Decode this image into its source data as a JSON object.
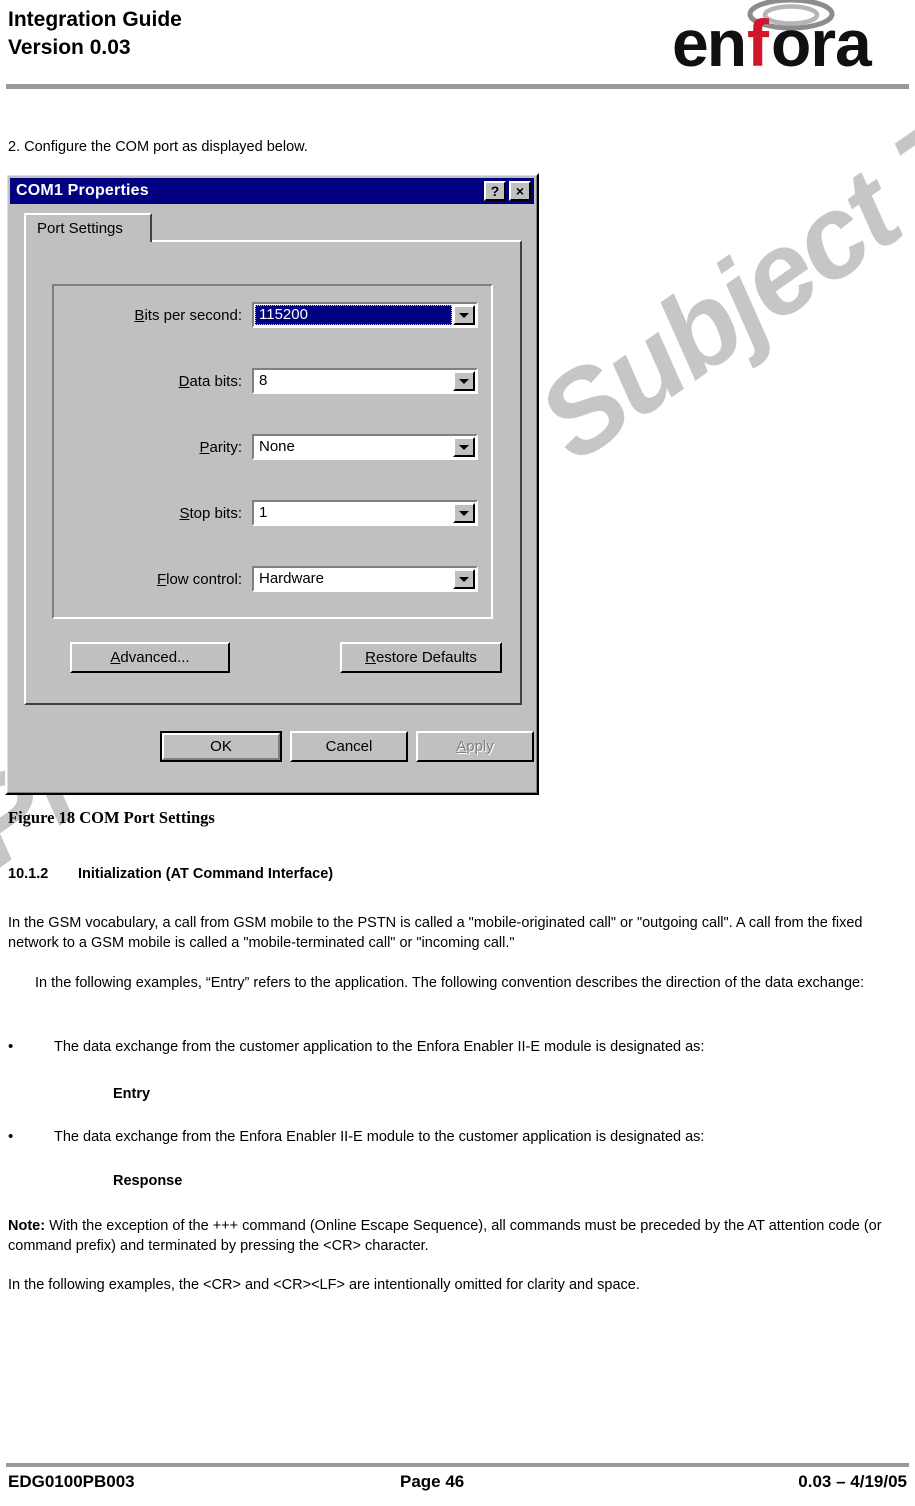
{
  "header": {
    "title_line1": "Integration Guide",
    "title_line2": "Version 0.03",
    "logo_text": "enfora",
    "logo_accent_letter": "f",
    "logo_accent_color": "#d2152a",
    "logo_black": "#101010",
    "rule_color": "#9a9a9a"
  },
  "watermark": {
    "text": "Preliminary - Subject To Change",
    "color": "#c6c6c6"
  },
  "body": {
    "step2": "2. Configure the COM port as displayed below.",
    "figure_caption": "Figure 18 COM Port Settings",
    "section_number": "10.1.2",
    "section_title": "Initialization (AT Command Interface)",
    "paragraph_gsm": "In the GSM vocabulary, a call from GSM mobile to the PSTN is called a \"mobile-originated call\" or \"outgoing call\".  A call from the fixed network to a GSM mobile is called a \"mobile-terminated call\" or \"incoming call.\"",
    "paragraph_entry": "In the following examples, “Entry” refers to the application.  The following convention describes the direction of the data exchange:",
    "bullet_1": "The data exchange from the customer application to the Enfora Enabler II-E module is designated as:",
    "keyword_entry": "Entry",
    "bullet_2": "The data exchange from the Enfora Enabler II-E module to the customer application is designated as:",
    "keyword_response": "Response",
    "bullet_glyph": "•",
    "note_label": "Note:",
    "note_text": " With the exception of the +++ command (Online Escape Sequence), all commands must be preceded by the AT attention code (or command prefix) and terminated by pressing the <CR> character.",
    "paragraph_last": "In the following examples, the <CR> and <CR><LF> are intentionally omitted for clarity and space."
  },
  "dialog": {
    "title": "COM1 Properties",
    "help_button": "?",
    "close_button": "×",
    "tab_label": "Port Settings",
    "titlebar_color": "#000080",
    "face_color": "#c0c0c0",
    "fields": [
      {
        "label_accel": "B",
        "label_rest": "its per second:",
        "value": "115200",
        "selected": true
      },
      {
        "label_accel": "D",
        "label_rest": "ata bits:",
        "value": "8",
        "selected": false
      },
      {
        "label_accel": "P",
        "label_rest": "arity:",
        "value": "None",
        "selected": false
      },
      {
        "label_accel": "S",
        "label_rest": "top bits:",
        "value": "1",
        "selected": false
      },
      {
        "label_accel": "F",
        "label_rest": "low control:",
        "value": "Hardware",
        "selected": false
      }
    ],
    "buttons": {
      "advanced_accel": "A",
      "advanced_rest": "dvanced...",
      "restore_accel": "R",
      "restore_rest": "estore Defaults",
      "ok": "OK",
      "cancel": "Cancel",
      "apply_accel": "A",
      "apply_rest": "pply"
    }
  },
  "footer": {
    "left": "EDG0100PB003",
    "center": "Page 46",
    "right": "0.03 – 4/19/05"
  }
}
